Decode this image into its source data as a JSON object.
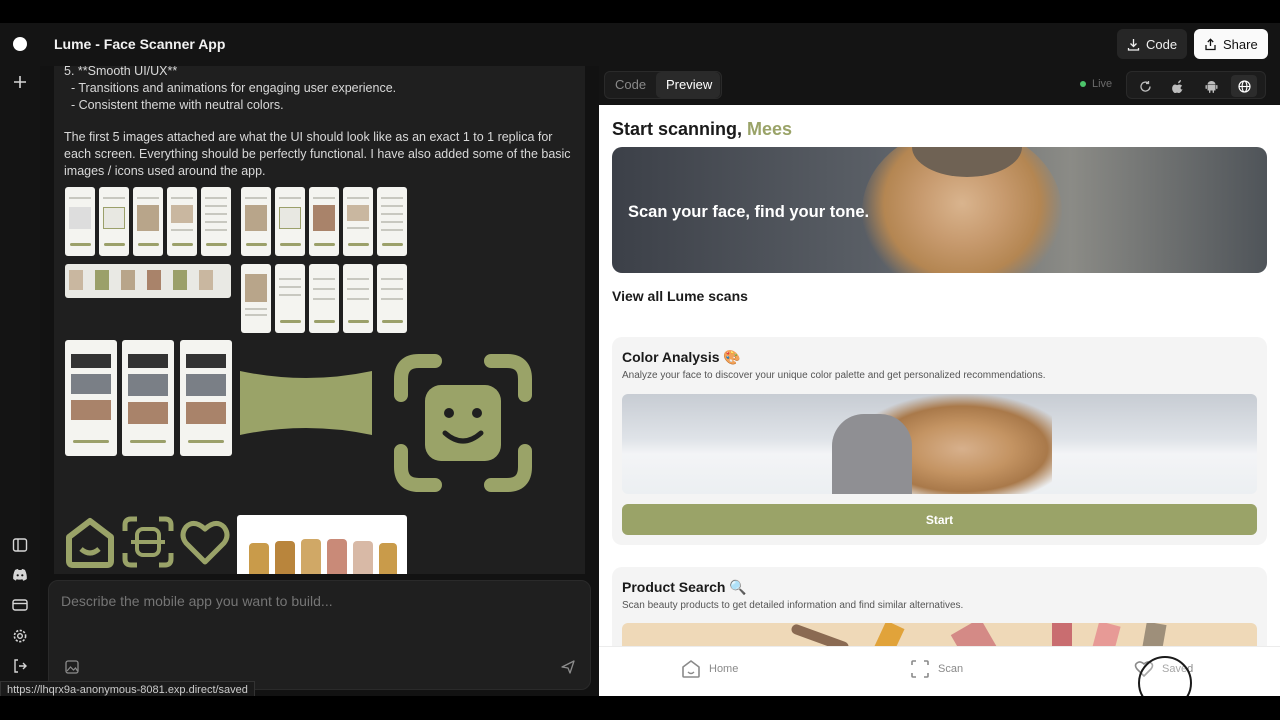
{
  "app": {
    "title": "Lume - Face Scanner App"
  },
  "header": {
    "code_button": "Code",
    "share_button": "Share"
  },
  "chat": {
    "lines": [
      "5. **Smooth UI/UX**",
      "  - Transitions and animations for engaging user experience.",
      "  - Consistent theme with neutral colors."
    ],
    "paragraph": "The first 5 images attached are what the UI should look like as an exact 1 to 1 replica for each screen. Everything should be perfectly functional. I have also added some of the basic images / icons used around the app."
  },
  "composer": {
    "placeholder": "Describe the mobile app you want to build..."
  },
  "status_url": "https://lhqrx9a-anonymous-8081.exp.direct/saved",
  "preview": {
    "tabs": [
      "Code",
      "Preview"
    ],
    "active_tab": "Preview",
    "live_label": "Live"
  },
  "phone": {
    "greeting_prefix": "Start scanning, ",
    "greeting_name": "Mees",
    "hero_text": "Scan your face, find your tone.",
    "section_title": "View all Lume scans",
    "cards": [
      {
        "title": "Color Analysis 🎨",
        "subtitle": "Analyze your face to discover your unique color palette and get personalized recommendations.",
        "button": "Start"
      },
      {
        "title": "Product Search 🔍",
        "subtitle": "Scan beauty products to get detailed information and find similar alternatives."
      }
    ],
    "tabbar": {
      "home": "Home",
      "scan": "Scan",
      "saved": "Saved"
    }
  },
  "colors": {
    "accent": "#9aa368",
    "panel": "#1f1f1f",
    "background": "#121212"
  },
  "icons": [
    "logo-dot",
    "plus-icon",
    "sidebar-icon",
    "discord-icon",
    "card-icon",
    "gear-icon",
    "logout-icon",
    "download-icon",
    "share-icon",
    "refresh-icon",
    "apple-icon",
    "android-icon",
    "globe-icon",
    "image-icon",
    "send-icon",
    "home-icon",
    "scan-icon",
    "heart-icon"
  ]
}
